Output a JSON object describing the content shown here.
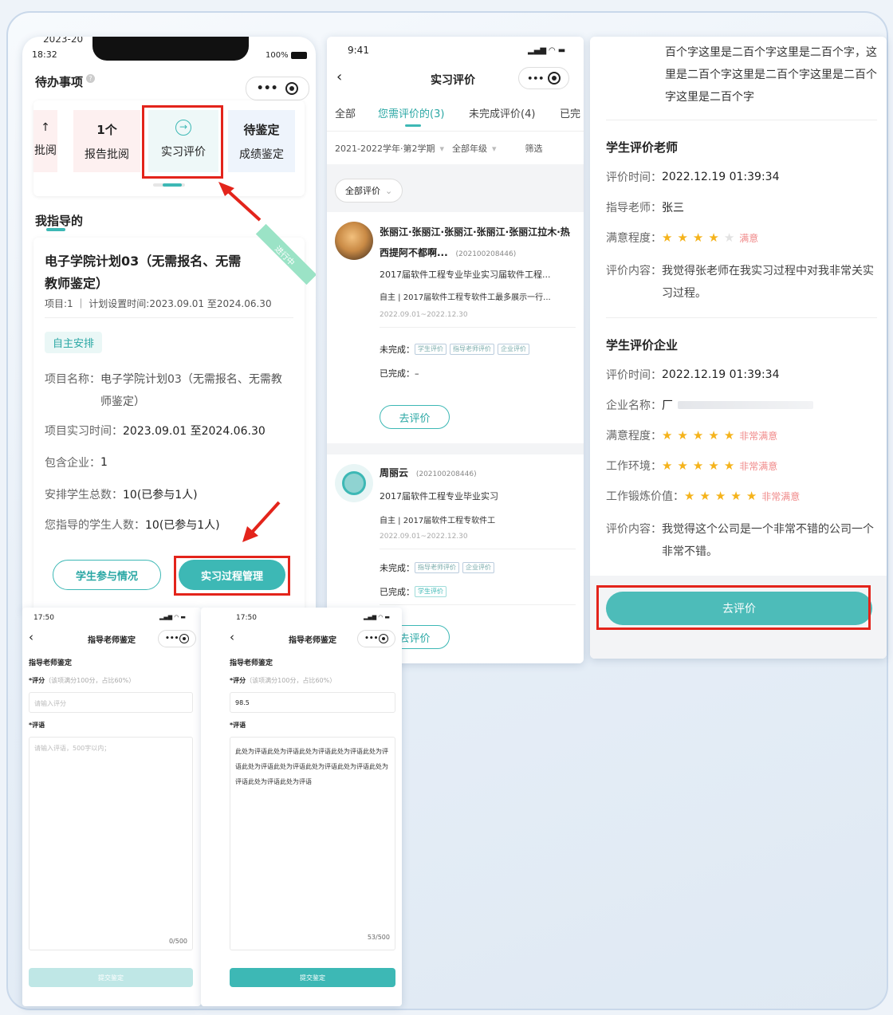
{
  "p1": {
    "clock_label": "2023-20",
    "time": "18:32",
    "battery": "100%",
    "title": "待办事项",
    "tiles": [
      {
        "top": "↑",
        "bottom": "批阅"
      },
      {
        "top": "1个",
        "bottom": "报告批阅"
      },
      {
        "top": "",
        "bottom": "实习评价"
      },
      {
        "top": "待鉴定",
        "bottom": "成绩鉴定"
      }
    ],
    "section": "我指导的",
    "ribbon": "进行中",
    "plan_title": "电子学院计划03（无需报名、无需教师鉴定）",
    "plan_meta": "项目:1 ｜ 计划设置时间:2023.09.01 至2024.06.30",
    "badge": "自主安排",
    "fields": [
      {
        "k": "项目名称：",
        "v": "电子学院计划03（无需报名、无需教师鉴定）"
      },
      {
        "k": "项目实习时间：",
        "v": "2023.09.01 至2024.06.30"
      },
      {
        "k": "包含企业：",
        "v": "1"
      },
      {
        "k": "安排学生总数：",
        "v": "10(已参与1人)"
      },
      {
        "k": "您指导的学生人数：",
        "v": "10(已参与1人)"
      }
    ],
    "btn_left": "学生参与情况",
    "btn_right": "实习过程管理"
  },
  "p2": {
    "time": "9:41",
    "title": "实习评价",
    "tabs": [
      "全部",
      "您需评价的(3)",
      "未完成评价(4)",
      "已完"
    ],
    "filter1": "2021-2022学年·第2学期",
    "filter2": "全部年级",
    "filter3": "筛选",
    "chip": "全部评价",
    "cards": [
      {
        "name": "张丽江·张丽江·张丽江·张丽江·张丽江拉木·热西提阿不都啊...",
        "id": "(202100208446)",
        "line1": "2017届软件工程专业毕业实习届软件工程...",
        "line2": "自主 | 2017届软件工程专软件工最多展示一行...",
        "date": "2022.09.01~2022.12.30",
        "undone_label": "未完成：",
        "undone_tags": [
          "学生评价",
          "指导老师评价",
          "企业评价"
        ],
        "done_label": "已完成：",
        "done_value": "–",
        "done_tags": [],
        "button": "去评价"
      },
      {
        "name": "周丽云",
        "id": "(202100208446)",
        "line1": "2017届软件工程专业毕业实习",
        "line2": "自主 | 2017届软件工程专软件工",
        "date": "2022.09.01~2022.12.30",
        "undone_label": "未完成：",
        "undone_tags": [
          "指导老师评价",
          "企业评价"
        ],
        "done_label": "已完成：",
        "done_value": "",
        "done_tags": [
          "学生评价"
        ],
        "button": "去评价"
      }
    ]
  },
  "p3": {
    "top_text": "百个字这里是二百个字这里是二百个字，这里是二百个字这里是二百个字这里是二百个字这里是二百个字",
    "sec1": "学生评价老师",
    "sec1_rows": [
      {
        "k": "评价时间：",
        "v": "2022.12.19 01:39:34"
      },
      {
        "k": "指导老师：",
        "v": "张三"
      }
    ],
    "sec1_rating": {
      "k": "满意程度：",
      "stars": 4,
      "label": "满意"
    },
    "sec1_comment": {
      "k": "评价内容：",
      "v": "我觉得张老师在我实习过程中对我非常关实习过程。"
    },
    "sec2": "学生评价企业",
    "sec2_rows": [
      {
        "k": "评价时间：",
        "v": "2022.12.19 01:39:34"
      },
      {
        "k": "企业名称：",
        "v": "厂"
      }
    ],
    "sec2_ratings": [
      {
        "k": "满意程度：",
        "stars": 5,
        "label": "非常满意"
      },
      {
        "k": "工作环境：",
        "stars": 5,
        "label": "非常满意"
      },
      {
        "k": "工作锻炼价值：",
        "stars": 5,
        "label": "非常满意"
      }
    ],
    "sec2_comment": {
      "k": "评价内容：",
      "v": "我觉得这个公司是一个非常不错的公司一个非常不错。"
    },
    "button": "去评价"
  },
  "p4": {
    "time": "17:50",
    "title": "指导老师鉴定",
    "section": "指导老师鉴定",
    "score_label": "*评分",
    "score_hint": "（该项满分100分，占比60%）",
    "score_placeholder": "请输入评分",
    "comment_label": "*评语",
    "comment_placeholder": "请输入评语，500字以内；",
    "counter": "0/500",
    "submit": "提交鉴定"
  },
  "p5": {
    "time": "17:50",
    "title": "指导老师鉴定",
    "section": "指导老师鉴定",
    "score_label": "*评分",
    "score_hint": "（该项满分100分，占比60%）",
    "score_value": "98.5",
    "comment_label": "*评语",
    "comment_value": "此处为评语此处为评语此处为评语此处为评语此处为评语此处为评语此处为评语此处为评语此处为评语此处为评语此处为评语此处为评语",
    "counter": "53/500",
    "submit": "提交鉴定"
  },
  "colors": {
    "accent": "#3db8b5",
    "highlight": "#e3241b",
    "star": "#f5b31b"
  }
}
